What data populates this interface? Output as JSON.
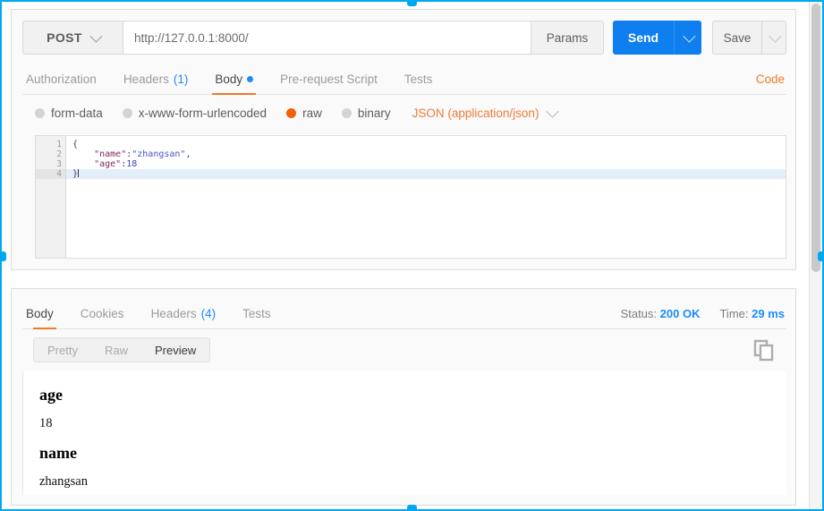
{
  "request": {
    "method": "POST",
    "method_caret_icon": "chevron-down-icon",
    "url_value": "http://127.0.0.1:8000/",
    "url_placeholder": "Enter request URL",
    "params_label": "Params",
    "send_label": "Send",
    "send_caret_icon": "chevron-down-icon",
    "save_label": "Save",
    "save_caret_icon": "chevron-down-icon",
    "tabs": [
      {
        "label": "Authorization",
        "count": "",
        "active": false,
        "dot": false
      },
      {
        "label": "Headers",
        "count": "(1)",
        "active": false,
        "dot": false
      },
      {
        "label": "Body",
        "count": "",
        "active": true,
        "dot": true
      },
      {
        "label": "Pre-request Script",
        "count": "",
        "active": false,
        "dot": false
      },
      {
        "label": "Tests",
        "count": "",
        "active": false,
        "dot": false
      }
    ],
    "code_link_label": "Code",
    "body_types": [
      {
        "label": "form-data",
        "checked": false
      },
      {
        "label": "x-www-form-urlencoded",
        "checked": false
      },
      {
        "label": "raw",
        "checked": true
      },
      {
        "label": "binary",
        "checked": false
      }
    ],
    "content_type": "JSON (application/json)",
    "content_type_caret_icon": "chevron-down-icon",
    "editor": {
      "gutter": [
        "1",
        "2",
        "3",
        "4"
      ],
      "active_line": 4,
      "fold_line": 1,
      "lines": [
        {
          "n": 1,
          "segments": [
            {
              "t": "punct",
              "v": "{"
            }
          ]
        },
        {
          "n": 2,
          "segments": [
            {
              "t": "plain",
              "v": "    "
            },
            {
              "t": "key",
              "v": "\"name\""
            },
            {
              "t": "punct",
              "v": ":"
            },
            {
              "t": "string",
              "v": "\"zhangsan\""
            },
            {
              "t": "punct",
              "v": ","
            }
          ]
        },
        {
          "n": 3,
          "segments": [
            {
              "t": "plain",
              "v": "    "
            },
            {
              "t": "key",
              "v": "\"age\""
            },
            {
              "t": "punct",
              "v": ":"
            },
            {
              "t": "num",
              "v": "18"
            }
          ]
        },
        {
          "n": 4,
          "segments": [
            {
              "t": "punct",
              "v": "}"
            }
          ]
        }
      ]
    }
  },
  "response": {
    "tabs": [
      {
        "label": "Body",
        "count": "",
        "active": true
      },
      {
        "label": "Cookies",
        "count": "",
        "active": false
      },
      {
        "label": "Headers",
        "count": "(4)",
        "active": false
      },
      {
        "label": "Tests",
        "count": "",
        "active": false
      }
    ],
    "status_label": "Status:",
    "status_value": "200 OK",
    "time_label": "Time:",
    "time_value": "29 ms",
    "view_modes": [
      {
        "label": "Pretty",
        "active": false
      },
      {
        "label": "Raw",
        "active": false
      },
      {
        "label": "Preview",
        "active": true
      }
    ],
    "copy_icon": "copy-icon",
    "preview_blocks": [
      {
        "kind": "heading",
        "text": "age"
      },
      {
        "kind": "paragraph",
        "text": "18"
      },
      {
        "kind": "heading",
        "text": "name"
      },
      {
        "kind": "paragraph",
        "text": "zhangsan"
      }
    ]
  },
  "colors": {
    "accent_blue": "#0f7ff0",
    "accent_orange": "#f07a28",
    "radio_orange": "#f2610c",
    "link_blue": "#1a8cff",
    "selection_cyan": "#00a8f0"
  }
}
